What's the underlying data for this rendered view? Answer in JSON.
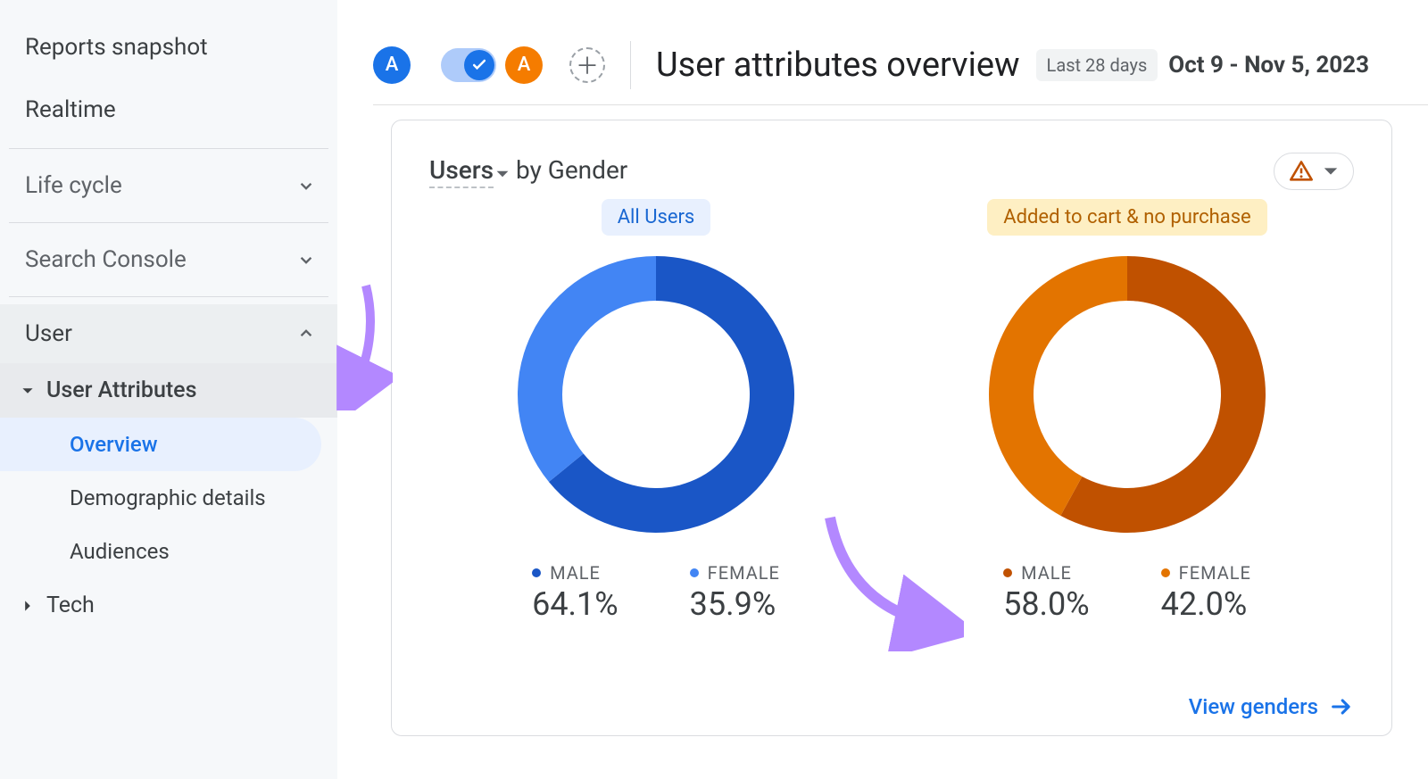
{
  "sidebar": {
    "reports_snapshot": "Reports snapshot",
    "realtime": "Realtime",
    "life_cycle": "Life cycle",
    "search_console": "Search Console",
    "user": "User",
    "user_attributes": "User Attributes",
    "overview": "Overview",
    "demographic_details": "Demographic details",
    "audiences": "Audiences",
    "tech": "Tech"
  },
  "header": {
    "badge_letter": "A",
    "page_title": "User attributes overview",
    "range_label": "Last 28 days",
    "date_range": "Oct 9 - Nov 5, 2023"
  },
  "card": {
    "metric_label": "Users",
    "dimension_prefix": " by ",
    "dimension_label": "Gender",
    "view_link": "View genders"
  },
  "segments": {
    "all_users": "All Users",
    "added_to_cart": "Added to cart & no purchase"
  },
  "legend_labels": {
    "male": "MALE",
    "female": "FEMALE"
  },
  "colors": {
    "blue_dark": "#1a56c6",
    "blue_light": "#4285f4",
    "orange_dark": "#c05100",
    "orange_light": "#e37400",
    "link": "#1a73e8",
    "annotation": "#b388ff"
  },
  "chart_data": [
    {
      "type": "pie",
      "title": "All Users — Users by Gender",
      "segment": "All Users",
      "series": [
        {
          "name": "MALE",
          "value": 64.1,
          "color": "#1a56c6"
        },
        {
          "name": "FEMALE",
          "value": 35.9,
          "color": "#4285f4"
        }
      ],
      "donut": true
    },
    {
      "type": "pie",
      "title": "Added to cart & no purchase — Users by Gender",
      "segment": "Added to cart & no purchase",
      "series": [
        {
          "name": "MALE",
          "value": 58.0,
          "color": "#c05100"
        },
        {
          "name": "FEMALE",
          "value": 42.0,
          "color": "#e37400"
        }
      ],
      "donut": true
    }
  ]
}
